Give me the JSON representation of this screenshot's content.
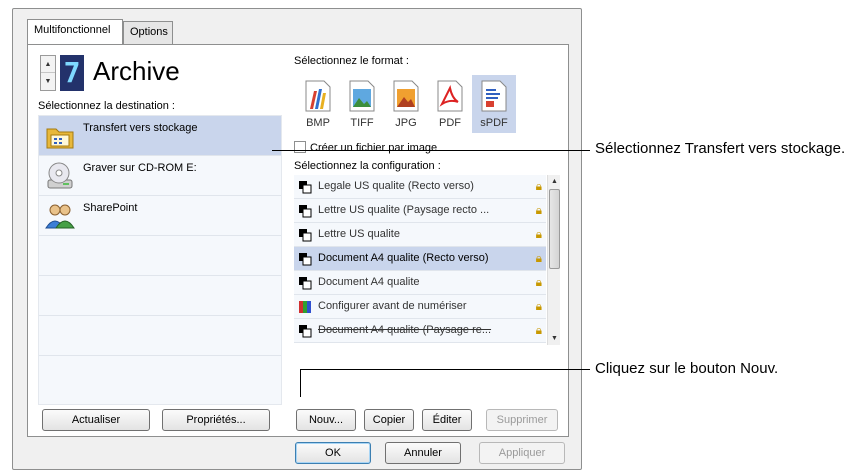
{
  "tabs": {
    "multi": "Multifonctionnel",
    "options": "Options"
  },
  "destination": {
    "counter": "7",
    "title": "Archive",
    "label": "Sélectionnez la destination :",
    "items": [
      {
        "label": "Transfert vers stockage",
        "icon": "folder-storage-icon"
      },
      {
        "label": "Graver sur CD-ROM  E:",
        "icon": "cd-drive-icon"
      },
      {
        "label": "SharePoint",
        "icon": "sharepoint-icon"
      }
    ],
    "refresh_label": "Actualiser",
    "properties_label": "Propriétés..."
  },
  "format": {
    "label": "Sélectionnez le format :",
    "items": [
      "BMP",
      "TIFF",
      "JPG",
      "PDF",
      "sPDF"
    ],
    "selected": "sPDF"
  },
  "per_image": {
    "label": "Créer un fichier par image",
    "checked": false
  },
  "config": {
    "label": "Sélectionnez la configuration :",
    "items": [
      "Legale US qualite (Recto verso)",
      "Lettre US qualite (Paysage recto ...",
      "Lettre US qualite",
      "Document A4 qualite (Recto verso)",
      "Document A4 qualite",
      "Configurer avant de numériser",
      "Document A4 qualite (Paysage re..."
    ],
    "selected_index": 3,
    "new_label": "Nouv...",
    "copy_label": "Copier",
    "edit_label": "Éditer",
    "delete_label": "Supprimer"
  },
  "footer": {
    "ok": "OK",
    "cancel": "Annuler",
    "apply": "Appliquer"
  },
  "callouts": {
    "select_transfer": "Sélectionnez Transfert vers stockage.",
    "click_new": "Cliquez sur le bouton Nouv."
  }
}
